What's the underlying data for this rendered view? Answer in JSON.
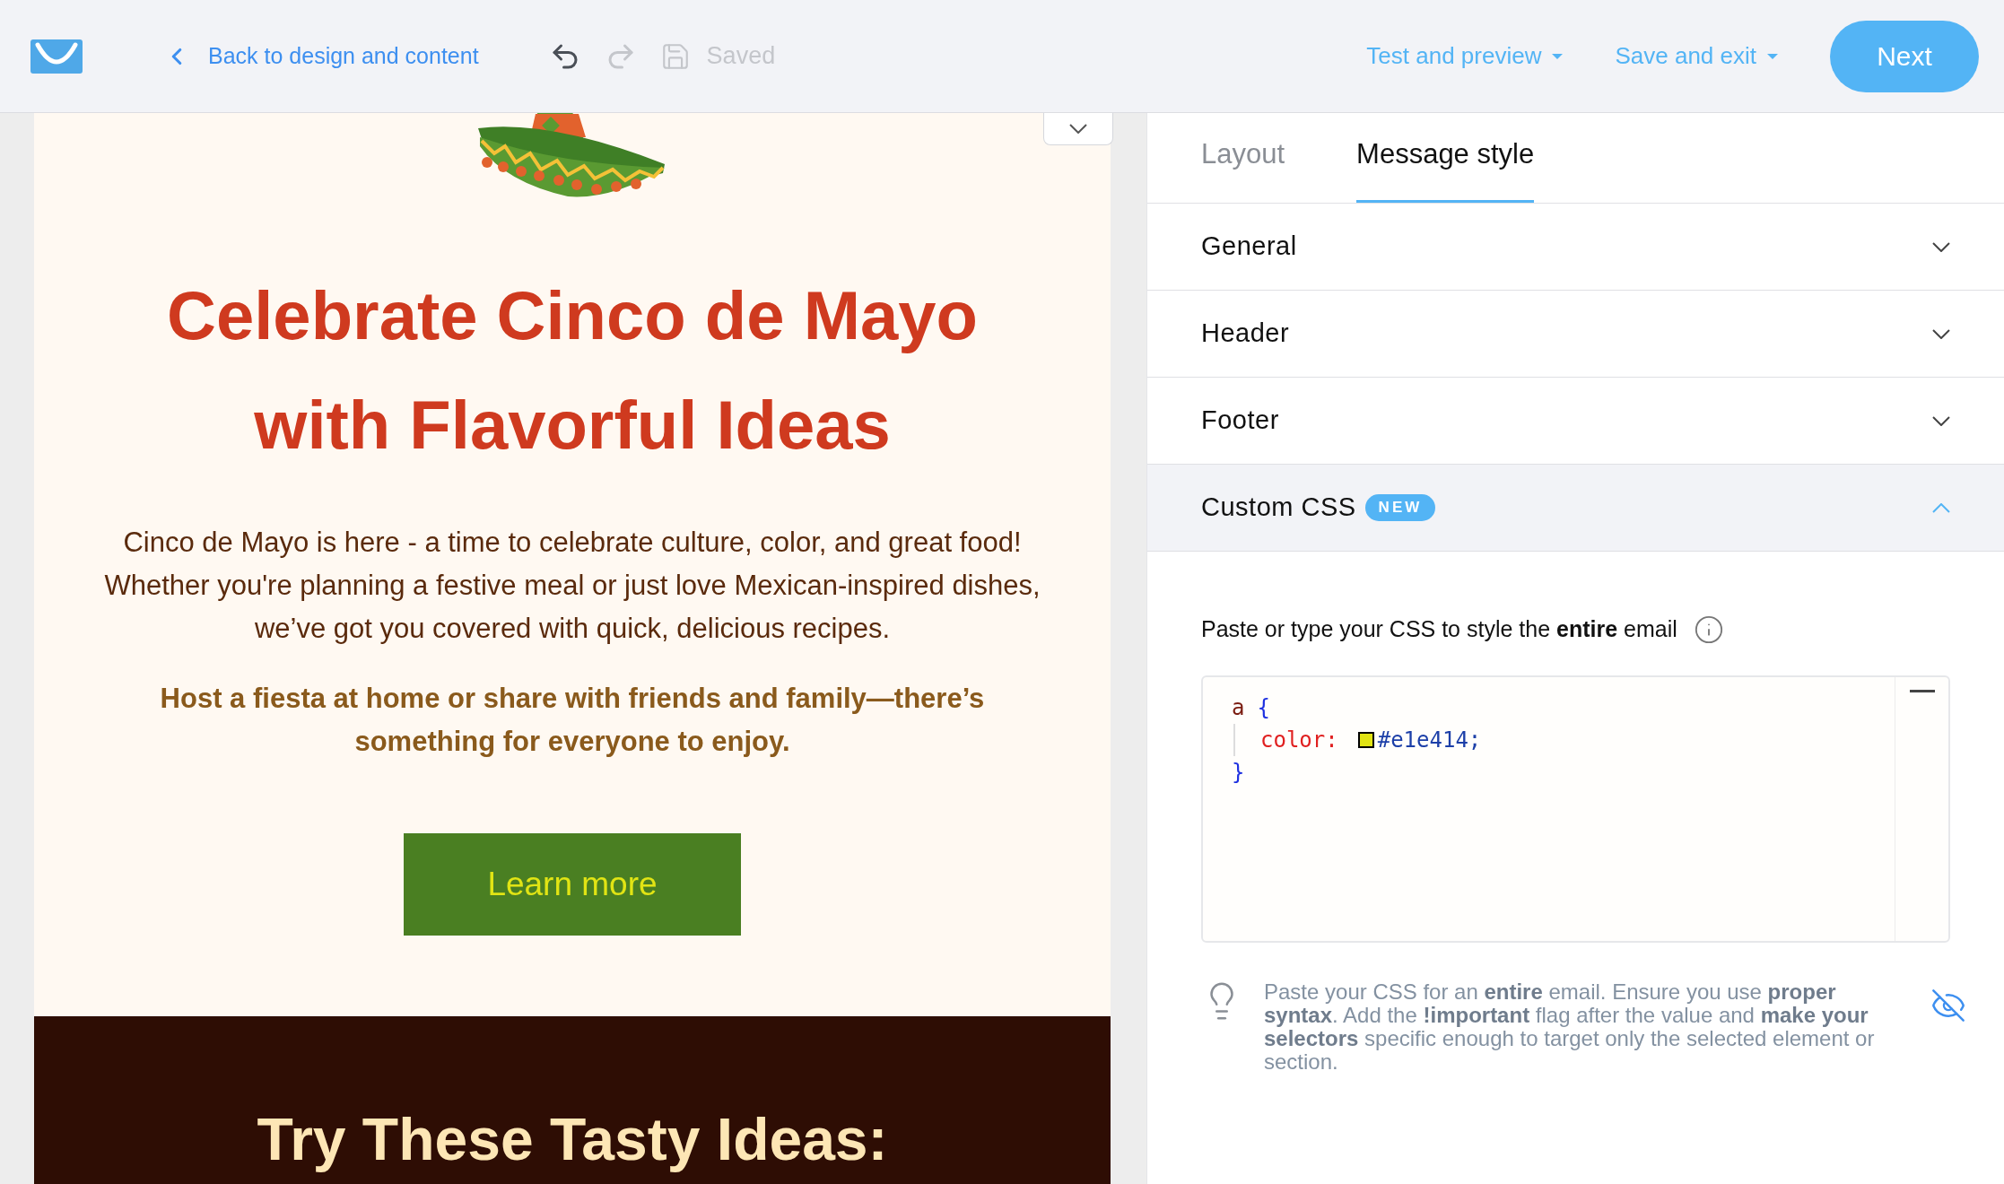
{
  "topbar": {
    "back_link": "Back to design and content",
    "undo": {
      "disabled": false
    },
    "redo": {
      "disabled": true
    },
    "save_status": "Saved",
    "menus": [
      "Test and preview",
      "Save and exit"
    ],
    "next_button": "Next"
  },
  "email": {
    "title_lines": [
      "Celebrate Cinco de Mayo",
      "with Flavorful Ideas"
    ],
    "intro": "Cinco de Mayo is here - a time to celebrate culture, color, and great food! Whether you're planning a festive meal or just love Mexican-inspired dishes, we’ve got you covered with quick, delicious recipes.",
    "highlight": "Host a fiesta at home or share with friends and family—there’s something for everyone to enjoy.",
    "cta": "Learn more",
    "section_title": "Try These Tasty Ideas:"
  },
  "panel": {
    "tabs": [
      {
        "label": "Layout",
        "selected": false
      },
      {
        "label": "Message style",
        "selected": true
      }
    ],
    "sections": [
      {
        "label": "General",
        "expanded": false
      },
      {
        "label": "Header",
        "expanded": false
      },
      {
        "label": "Footer",
        "expanded": false
      },
      {
        "label": "Custom CSS",
        "badge": "NEW",
        "expanded": true
      }
    ],
    "instruction": "Paste or type your CSS to style the **entire** email",
    "code": {
      "selector": "a",
      "open": "{",
      "property": "color:",
      "swatch": {
        "color": "#e1e414"
      },
      "value": "#e1e414;",
      "close": "}"
    },
    "tip": "Paste your CSS for an **entire** email. Ensure you use **proper syntax**. Add the **!important** flag after the value and **make your selectors** specific enough to target only the selected element or section."
  }
}
